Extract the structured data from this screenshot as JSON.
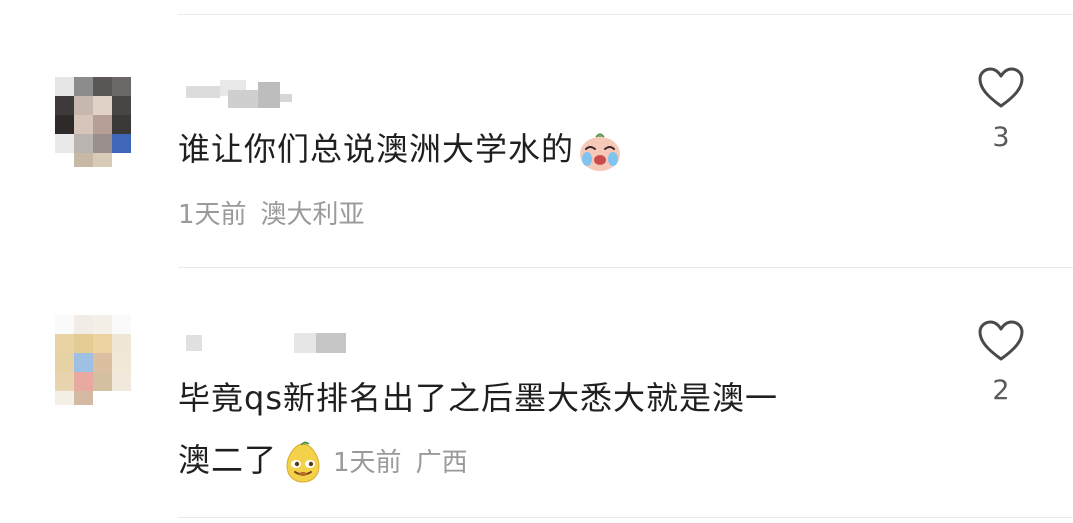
{
  "comments": [
    {
      "text": "谁让你们总说澳洲大学水的",
      "emoji": "crying-emoji",
      "time": "1天前",
      "location": "澳大利亚",
      "likes": "3"
    },
    {
      "text_line1": "毕竟qs新排名出了之后墨大悉大就是澳一",
      "text_line2": "澳二了",
      "emoji": "smug-pear-emoji",
      "time": "1天前",
      "location": "广西",
      "likes": "2"
    }
  ]
}
